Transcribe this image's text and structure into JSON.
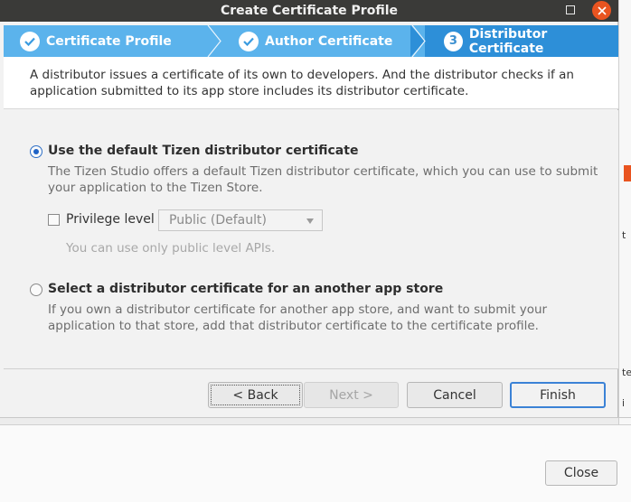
{
  "window": {
    "title": "Create Certificate Profile",
    "minimize_icon": "minimize-icon",
    "close_icon": "close-icon"
  },
  "steps": [
    {
      "label": "Certificate Profile",
      "state": "done",
      "icon": "check-icon"
    },
    {
      "label": "Author Certificate",
      "state": "done",
      "icon": "check-icon"
    },
    {
      "label": "Distributor Certificate",
      "state": "active",
      "number": "3"
    }
  ],
  "description": {
    "line1": "A distributor issues a certificate of its own to developers. And the distributor checks if an",
    "line2": "application submitted to its app store includes its distributor certificate."
  },
  "options": {
    "default": {
      "title": "Use the default Tizen distributor certificate",
      "desc_line1": "The Tizen Studio offers a default Tizen distributor certificate, which you can use to submit",
      "desc_line2": "your application to the Tizen Store.",
      "selected": true
    },
    "privilege": {
      "label": "Privilege level",
      "checked": false,
      "select_value": "Public (Default)",
      "hint": "You can use only public level APIs."
    },
    "other": {
      "title": "Select a distributor certificate for an another app store",
      "desc_line1": "If you own a distributor certificate for another app store, and want to submit your",
      "desc_line2": "application to that store, add that distributor certificate to the certificate profile.",
      "selected": false
    }
  },
  "buttons": {
    "back": "< Back",
    "next": "Next >",
    "cancel": "Cancel",
    "finish": "Finish"
  },
  "background": {
    "close_button": "Close",
    "side_t1": "t",
    "side_t2": "te",
    "side_t3": "i",
    "accent": "#e95420"
  },
  "colors": {
    "step_bar": "#5bb3ec",
    "step_active": "#2d8fd8",
    "titlebar": "#3a3a38"
  }
}
